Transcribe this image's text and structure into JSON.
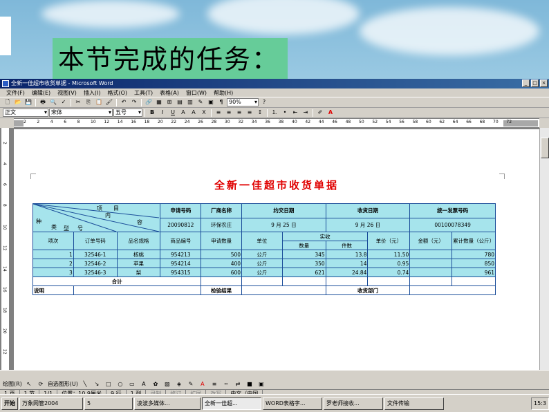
{
  "slide": {
    "title": "本节完成的任务："
  },
  "window": {
    "title": "全新一佳超市收货单据 - Microsoft Word",
    "min": "_",
    "max": "□",
    "close": "×"
  },
  "menu": [
    "文件(F)",
    "编辑(E)",
    "视图(V)",
    "插入(I)",
    "格式(O)",
    "工具(T)",
    "表格(A)",
    "窗口(W)",
    "帮助(H)"
  ],
  "toolbar": {
    "zoom": "90%",
    "help": "?"
  },
  "format": {
    "style": "正文",
    "font": "宋体",
    "size": "五号",
    "bold": "B",
    "italic": "I",
    "underline": "U",
    "font_color": "A"
  },
  "ruler": {
    "ticks": [
      "2",
      "2",
      "4",
      "6",
      "8",
      "10",
      "12",
      "14",
      "16",
      "18",
      "20",
      "22",
      "24",
      "26",
      "28",
      "30",
      "32",
      "34",
      "36",
      "38",
      "40",
      "42",
      "44",
      "46",
      "48",
      "50",
      "52",
      "54",
      "56",
      "58",
      "60",
      "62",
      "64",
      "66",
      "68",
      "70",
      "72"
    ]
  },
  "vruler": {
    "ticks": [
      "2",
      "4",
      "6",
      "8",
      "10",
      "12",
      "14",
      "16",
      "18",
      "20",
      "22"
    ]
  },
  "doc": {
    "title": "全新一佳超市收货单据",
    "hdr": {
      "xiangmu": "项　　目",
      "nei": "内",
      "rong": "容",
      "zhong": "种",
      "lei": "类",
      "xing": "型",
      "hao": "号"
    },
    "top_headers": [
      "申请号码",
      "厂商名称",
      "约交日期",
      "收货日期",
      "统一发票号码"
    ],
    "top_values": [
      "20090812",
      "环保农庄",
      "9 月 25 日",
      "9 月 26 日",
      "00100078349"
    ],
    "col_headers": [
      "项次",
      "订单号码",
      "品名规格",
      "商品编号",
      "申请数量",
      "单位",
      "实收",
      "单价（元）",
      "金额（元）",
      "累计数量（公斤）"
    ],
    "sub_headers": [
      "数量",
      "件数"
    ],
    "rows": [
      [
        "1",
        "32546-1",
        "核桃",
        "954213",
        "500",
        "公斤",
        "345",
        "13.8",
        "11.50",
        "",
        "780"
      ],
      [
        "2",
        "32546-2",
        "苹果",
        "954214",
        "400",
        "公斤",
        "350",
        "14",
        "0.95",
        "",
        "850"
      ],
      [
        "3",
        "32546-3",
        "梨",
        "954315",
        "600",
        "公斤",
        "621",
        "24.84",
        "0.74",
        "",
        "961"
      ]
    ],
    "total_label": "合计",
    "footer": {
      "note": "说明",
      "inspect": "检验结果",
      "dept": "收货部门"
    }
  },
  "drawbar": {
    "draw": "绘图(R)",
    "autoshapes": "自选图形(U)"
  },
  "status": {
    "page": "1 页",
    "section": "1 节",
    "pages": "1/1",
    "pos": "位置：10.9厘米",
    "line": "9 行",
    "col": "1 列",
    "rec": "录制",
    "trk": "修订",
    "ext": "扩展",
    "ovr": "改写",
    "lang": "中文（中国"
  },
  "taskbar": {
    "start": "开始",
    "items": [
      "万象网管2004",
      "5",
      "凌波多媒体...",
      "全新一佳超...",
      "WORD表格字...",
      "罗老师接收...",
      "文件传输"
    ],
    "clock": "15:3"
  }
}
